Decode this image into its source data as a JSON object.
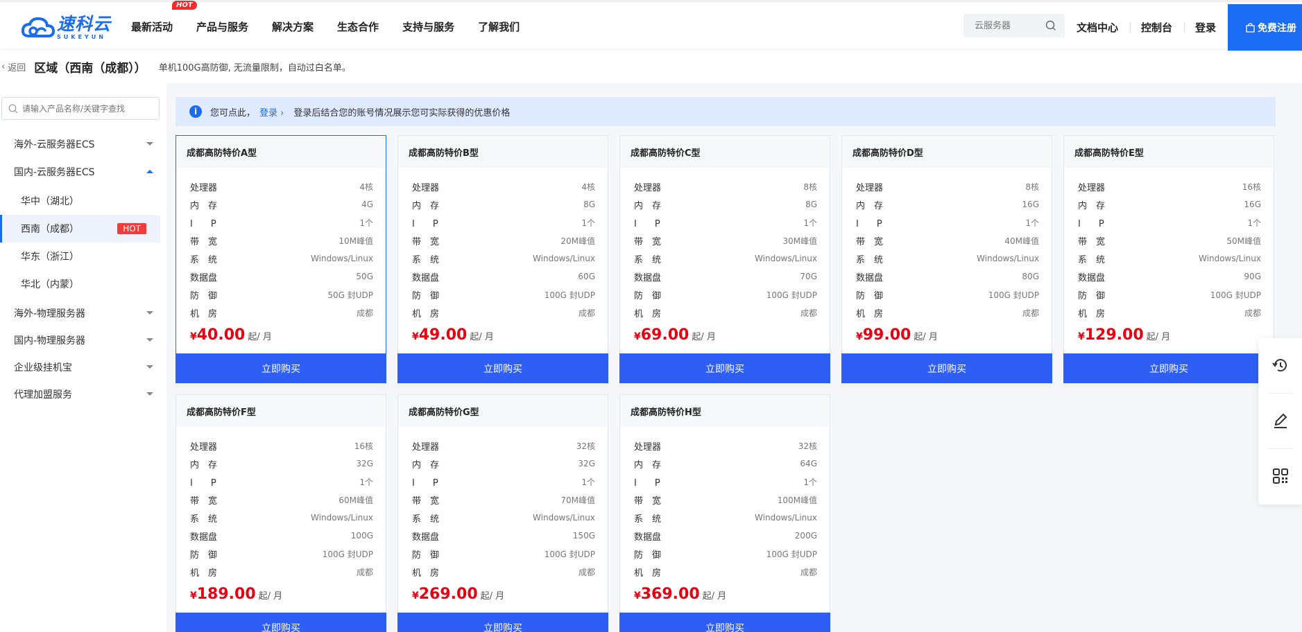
{
  "header": {
    "logo_cn": "速科云",
    "logo_en": "SUKEYUN",
    "nav": [
      "最新活动",
      "产品与服务",
      "解决方案",
      "生态合作",
      "支持与服务",
      "了解我们"
    ],
    "hot_badge": "HOT",
    "search_placeholder": "云服务器",
    "doc_center": "文档中心",
    "console": "控制台",
    "login": "登录",
    "register": "免费注册"
  },
  "subhead": {
    "back": "返回",
    "title": "区域（西南（成都））",
    "desc": "单机100G高防御, 无流量限制，自动过白名单。"
  },
  "sidebar": {
    "search_placeholder": "请输入产品名称/关键字查找",
    "items": [
      {
        "label": "海外-云服务器ECS"
      },
      {
        "label": "国内-云服务器ECS"
      },
      {
        "label": "华中（湖北）"
      },
      {
        "label": "西南（成都）",
        "badge": "HOT"
      },
      {
        "label": "华东（浙江）"
      },
      {
        "label": "华北（内蒙）"
      },
      {
        "label": "海外-物理服务器"
      },
      {
        "label": "国内-物理服务器"
      },
      {
        "label": "企业级挂机宝"
      },
      {
        "label": "代理加盟服务"
      }
    ]
  },
  "notice": {
    "prefix": "您可点此，",
    "login": "登录 ›",
    "suffix": "登录后结合您的账号情况展示您可实际获得的优惠价格"
  },
  "labels": {
    "cpu": "处理器",
    "mem": "内　存",
    "ip": "I　　P",
    "bw": "带　宽",
    "os": "系　统",
    "disk": "数据盘",
    "def": "防　御",
    "room": "机　房",
    "yen": "¥",
    "unit": "起/ 月",
    "buy": "立即购买"
  },
  "cards": [
    {
      "title": "成都高防特价A型",
      "cpu": "4核",
      "mem": "4G",
      "ip": "1个",
      "bw": "10M峰值",
      "os": "Windows/Linux",
      "disk": "50G",
      "def": "50G 封UDP",
      "room": "成都",
      "price": "40.00"
    },
    {
      "title": "成都高防特价B型",
      "cpu": "4核",
      "mem": "8G",
      "ip": "1个",
      "bw": "20M峰值",
      "os": "Windows/Linux",
      "disk": "60G",
      "def": "100G 封UDP",
      "room": "成都",
      "price": "49.00"
    },
    {
      "title": "成都高防特价C型",
      "cpu": "8核",
      "mem": "8G",
      "ip": "1个",
      "bw": "30M峰值",
      "os": "Windows/Linux",
      "disk": "70G",
      "def": "100G 封UDP",
      "room": "成都",
      "price": "69.00"
    },
    {
      "title": "成都高防特价D型",
      "cpu": "8核",
      "mem": "16G",
      "ip": "1个",
      "bw": "40M峰值",
      "os": "Windows/Linux",
      "disk": "80G",
      "def": "100G 封UDP",
      "room": "成都",
      "price": "99.00"
    },
    {
      "title": "成都高防特价E型",
      "cpu": "16核",
      "mem": "16G",
      "ip": "1个",
      "bw": "50M峰值",
      "os": "Windows/Linux",
      "disk": "90G",
      "def": "100G 封UDP",
      "room": "成都",
      "price": "129.00"
    },
    {
      "title": "成都高防特价F型",
      "cpu": "16核",
      "mem": "32G",
      "ip": "1个",
      "bw": "60M峰值",
      "os": "Windows/Linux",
      "disk": "100G",
      "def": "100G 封UDP",
      "room": "成都",
      "price": "189.00"
    },
    {
      "title": "成都高防特价G型",
      "cpu": "32核",
      "mem": "32G",
      "ip": "1个",
      "bw": "70M峰值",
      "os": "Windows/Linux",
      "disk": "150G",
      "def": "100G 封UDP",
      "room": "成都",
      "price": "269.00"
    },
    {
      "title": "成都高防特价H型",
      "cpu": "32核",
      "mem": "64G",
      "ip": "1个",
      "bw": "100M峰值",
      "os": "Windows/Linux",
      "disk": "200G",
      "def": "100G 封UDP",
      "room": "成都",
      "price": "369.00"
    }
  ],
  "colors": {
    "brand": "#1a6cf5",
    "buy_button": "#2e5ef4",
    "price": "#e60012",
    "hot": "#f23c3c"
  },
  "icons": [
    "search-icon",
    "info-icon",
    "refresh-icon",
    "edit-icon",
    "qrcode-icon",
    "shopping-bag-icon"
  ]
}
